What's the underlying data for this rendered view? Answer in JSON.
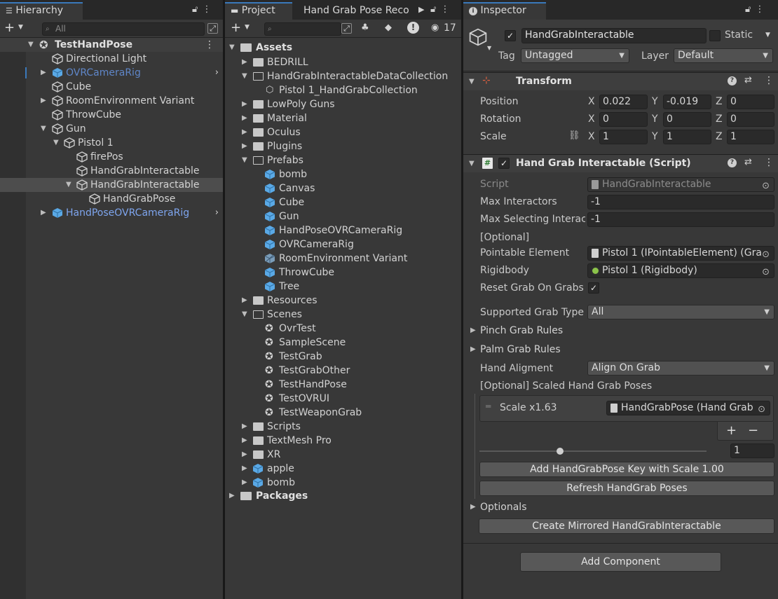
{
  "hierarchy": {
    "tab_label": "Hierarchy",
    "search_placeholder": "All",
    "scene": "TestHandPose",
    "items": [
      "Directional Light",
      "OVRCameraRig",
      "Cube",
      "RoomEnvironment Variant",
      "ThrowCube",
      "Gun",
      "Pistol 1",
      "firePos",
      "HandGrabInteractable",
      "HandGrabInteractable",
      "HandGrabPose",
      "HandPoseOVRCameraRig"
    ]
  },
  "project": {
    "tab_label": "Project",
    "tab2_label": "Hand Grab Pose Reco",
    "hidden_count": "17",
    "root": "Assets",
    "items": [
      "BEDRILL",
      "HandGrabInteractableDataCollection",
      "Pistol 1_HandGrabCollection",
      "LowPoly Guns",
      "Material",
      "Oculus",
      "Plugins",
      "Prefabs",
      "bomb",
      "Canvas",
      "Cube",
      "Gun",
      "HandPoseOVRCameraRig",
      "OVRCameraRig",
      "RoomEnvironment Variant",
      "ThrowCube",
      "Tree",
      "Resources",
      "Scenes",
      "OvrTest",
      "SampleScene",
      "TestGrab",
      "TestGrabOther",
      "TestHandPose",
      "TestOVRUI",
      "TestWeaponGrab",
      "Scripts",
      "TextMesh Pro",
      "XR",
      "apple",
      "bomb"
    ],
    "packages": "Packages"
  },
  "inspector": {
    "tab_label": "Inspector",
    "object_name": "HandGrabInteractable",
    "static_label": "Static",
    "tag_label": "Tag",
    "tag_value": "Untagged",
    "layer_label": "Layer",
    "layer_value": "Default",
    "transform": {
      "title": "Transform",
      "position_label": "Position",
      "rotation_label": "Rotation",
      "scale_label": "Scale",
      "x": "X",
      "y": "Y",
      "z": "Z",
      "pos_x": "0.022",
      "pos_y": "-0.019",
      "pos_z": "0",
      "rot_x": "0",
      "rot_y": "0",
      "rot_z": "0",
      "scl_x": "1",
      "scl_y": "1",
      "scl_z": "1"
    },
    "script": {
      "title": "Hand Grab Interactable (Script)",
      "script_label": "Script",
      "script_value": "HandGrabInteractable",
      "max_interactors_label": "Max Interactors",
      "max_interactors_value": "-1",
      "max_selecting_label": "Max Selecting Interac",
      "max_selecting_value": "-1",
      "optional_header": "[Optional]",
      "pointable_label": "Pointable Element",
      "pointable_value": "Pistol 1 (IPointableElement) (Gra",
      "rigidbody_label": "Rigidbody",
      "rigidbody_value": "Pistol 1 (Rigidbody)",
      "reset_grab_label": "Reset Grab On Grabs",
      "supported_grab_label": "Supported Grab Type",
      "supported_grab_value": "All",
      "pinch_rules": "Pinch Grab Rules",
      "palm_rules": "Palm Grab Rules",
      "hand_alignment_label": "Hand Aligment",
      "hand_alignment_value": "Align On Grab",
      "scaled_poses_label": "[Optional] Scaled Hand Grab Poses",
      "scale_item_label": "Scale x1.63",
      "scale_item_value": "HandGrabPose (Hand Grab",
      "plus": "+",
      "minus": "−",
      "slider_value": "1",
      "add_key_button": "Add HandGrabPose Key with Scale 1.00",
      "refresh_button": "Refresh HandGrab Poses",
      "optionals": "Optionals",
      "mirror_button": "Create Mirrored HandGrabInteractable"
    },
    "add_component": "Add Component"
  }
}
